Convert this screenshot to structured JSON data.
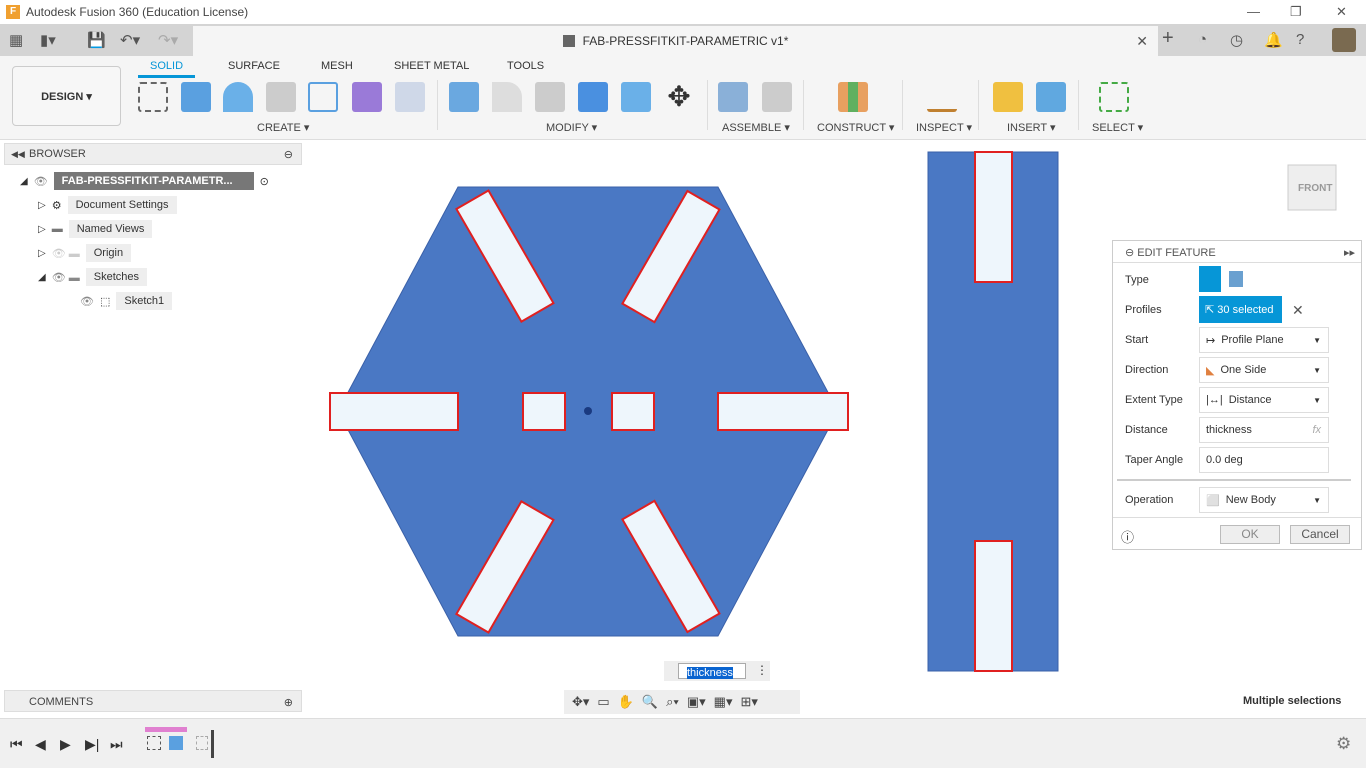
{
  "app": {
    "title": "Autodesk Fusion 360 (Education License)",
    "logo": "F"
  },
  "document": {
    "tab_title": "FAB-PRESSFITKIT-PARAMETRIC v1*"
  },
  "workspace": {
    "label": "DESIGN ▾"
  },
  "ribbon": {
    "tabs": [
      {
        "label": "SOLID",
        "active": true
      },
      {
        "label": "SURFACE"
      },
      {
        "label": "MESH"
      },
      {
        "label": "SHEET METAL"
      },
      {
        "label": "TOOLS"
      }
    ],
    "groups": [
      "CREATE ▾",
      "MODIFY ▾",
      "ASSEMBLE ▾",
      "CONSTRUCT ▾",
      "INSPECT ▾",
      "INSERT ▾",
      "SELECT ▾"
    ]
  },
  "browser": {
    "title": "BROWSER",
    "root": "FAB-PRESSFITKIT-PARAMETR...",
    "items": [
      "Document Settings",
      "Named Views",
      "Origin",
      "Sketches",
      "Sketch1"
    ]
  },
  "comments": {
    "title": "COMMENTS"
  },
  "edit_feature": {
    "title": "EDIT FEATURE",
    "type_label": "Type",
    "profiles_label": "Profiles",
    "profiles_value": "30 selected",
    "start_label": "Start",
    "start_value": "Profile Plane",
    "direction_label": "Direction",
    "direction_value": "One Side",
    "extent_label": "Extent Type",
    "extent_value": "Distance",
    "distance_label": "Distance",
    "distance_value": "thickness",
    "fx": "fx",
    "taper_label": "Taper Angle",
    "taper_value": "0.0 deg",
    "operation_label": "Operation",
    "operation_value": "New Body",
    "ok": "OK",
    "cancel": "Cancel"
  },
  "viewport": {
    "inline_input": "thickness",
    "viewcube": "FRONT",
    "status": "Multiple selections"
  },
  "colors": {
    "accent": "#0696d7",
    "body": "#4a78c4",
    "slot": "#eef6fc",
    "edge": "#e02020"
  }
}
